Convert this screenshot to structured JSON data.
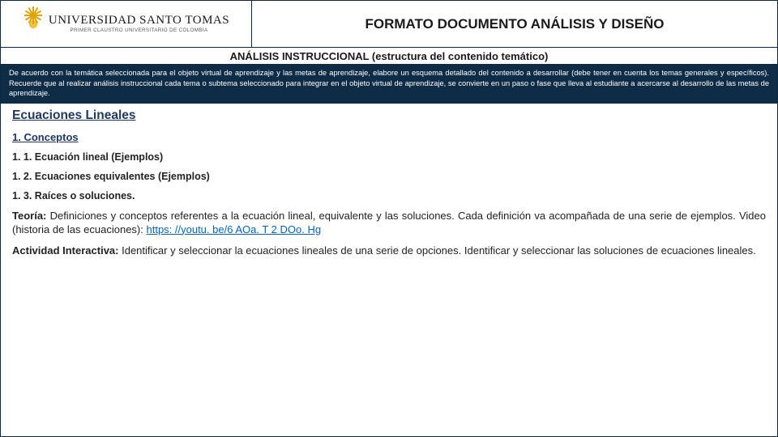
{
  "header": {
    "logo_main": "UNIVERSIDAD SANTO TOMAS",
    "logo_sub": "PRIMER CLAUSTRO UNIVERSITARIO DE COLOMBIA",
    "doc_title": "FORMATO DOCUMENTO ANÁLISIS Y DISEÑO"
  },
  "section": {
    "title": "ANÁLISIS INSTRUCCIONAL (estructura del contenido temático)",
    "instructions": "De acuerdo con la temática seleccionada para el objeto virtual de aprendizaje y las metas de aprendizaje, elabore un esquema detallado del contenido a desarrollar (debe tener en cuenta los temas generales y específicos). Recuerde que al realizar análisis instruccional cada tema o subtema seleccionado para integrar en el objeto virtual de aprendizaje, se convierte en un paso o fase que lleva al estudiante a acercarse al desarrollo de las metas de aprendizaje."
  },
  "content": {
    "topic": "Ecuaciones Lineales",
    "h2_1": "1. Conceptos",
    "i1": "1. 1. Ecuación lineal (Ejemplos)",
    "i2": "1. 2. Ecuaciones equivalentes (Ejemplos)",
    "i3": "1. 3. Raíces o soluciones.",
    "theory_lead": "Teoría:",
    "theory_body": "  Definiciones y conceptos referentes a la ecuación lineal, equivalente y las soluciones. Cada definición va acompañada de una serie de ejemplos. Video (historia de las ecuaciones): ",
    "theory_link": "https: //youtu. be/6 AOa. T 2 DOo. Hg",
    "activity_lead": "Actividad Interactiva:",
    "activity_body": " Identificar y seleccionar la ecuaciones lineales de una serie de opciones. Identificar y seleccionar las soluciones de ecuaciones lineales."
  }
}
